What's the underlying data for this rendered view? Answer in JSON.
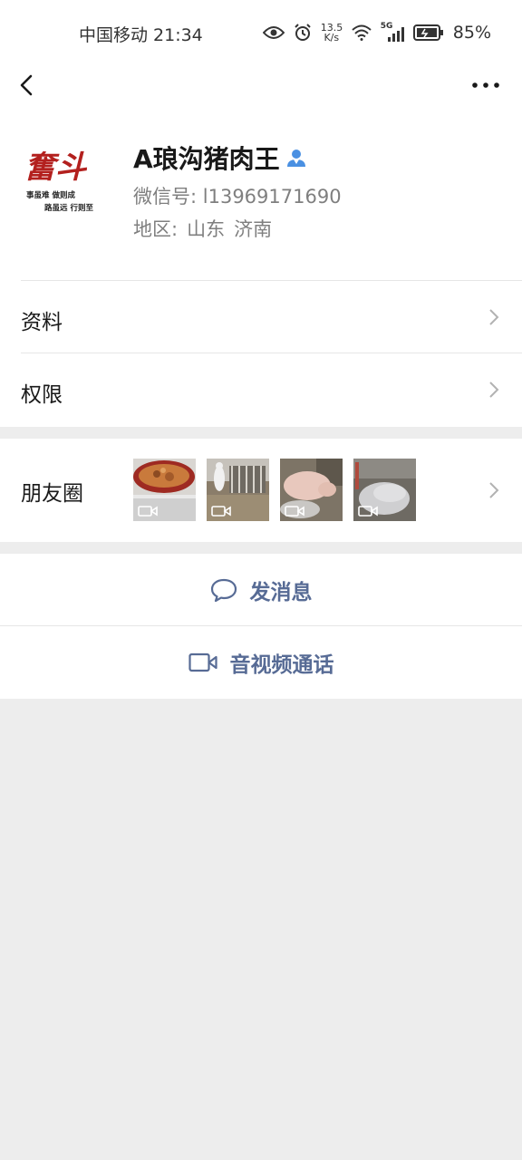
{
  "status_bar": {
    "carrier": "中国移动",
    "time": "21:34",
    "net_speed_value": "13.5",
    "net_speed_unit": "K/s",
    "network_type": "5G",
    "battery": "85%"
  },
  "icons": {
    "back": "chevron-left-icon",
    "more": "more-horizontal-icon",
    "contact_badge": "person-icon",
    "chat": "chat-bubble-icon",
    "video": "video-camera-icon"
  },
  "profile": {
    "avatar_text": {
      "main": "奮斗",
      "line1": "事虽难  做则成",
      "line2": "路虽远  行则至"
    },
    "nickname": "A琅沟猪肉王",
    "wxid_label": "微信号:",
    "wxid": "l13969171690",
    "region_label": "地区:",
    "region_province": "山东",
    "region_city": "济南"
  },
  "menu": {
    "profile_label": "资料",
    "permissions_label": "权限",
    "moments_label": "朋友圈"
  },
  "actions": {
    "message_label": "发消息",
    "call_label": "音视频通话"
  },
  "colors": {
    "accent": "#576b95",
    "background": "#ededed",
    "badge": "#4a90e2"
  }
}
